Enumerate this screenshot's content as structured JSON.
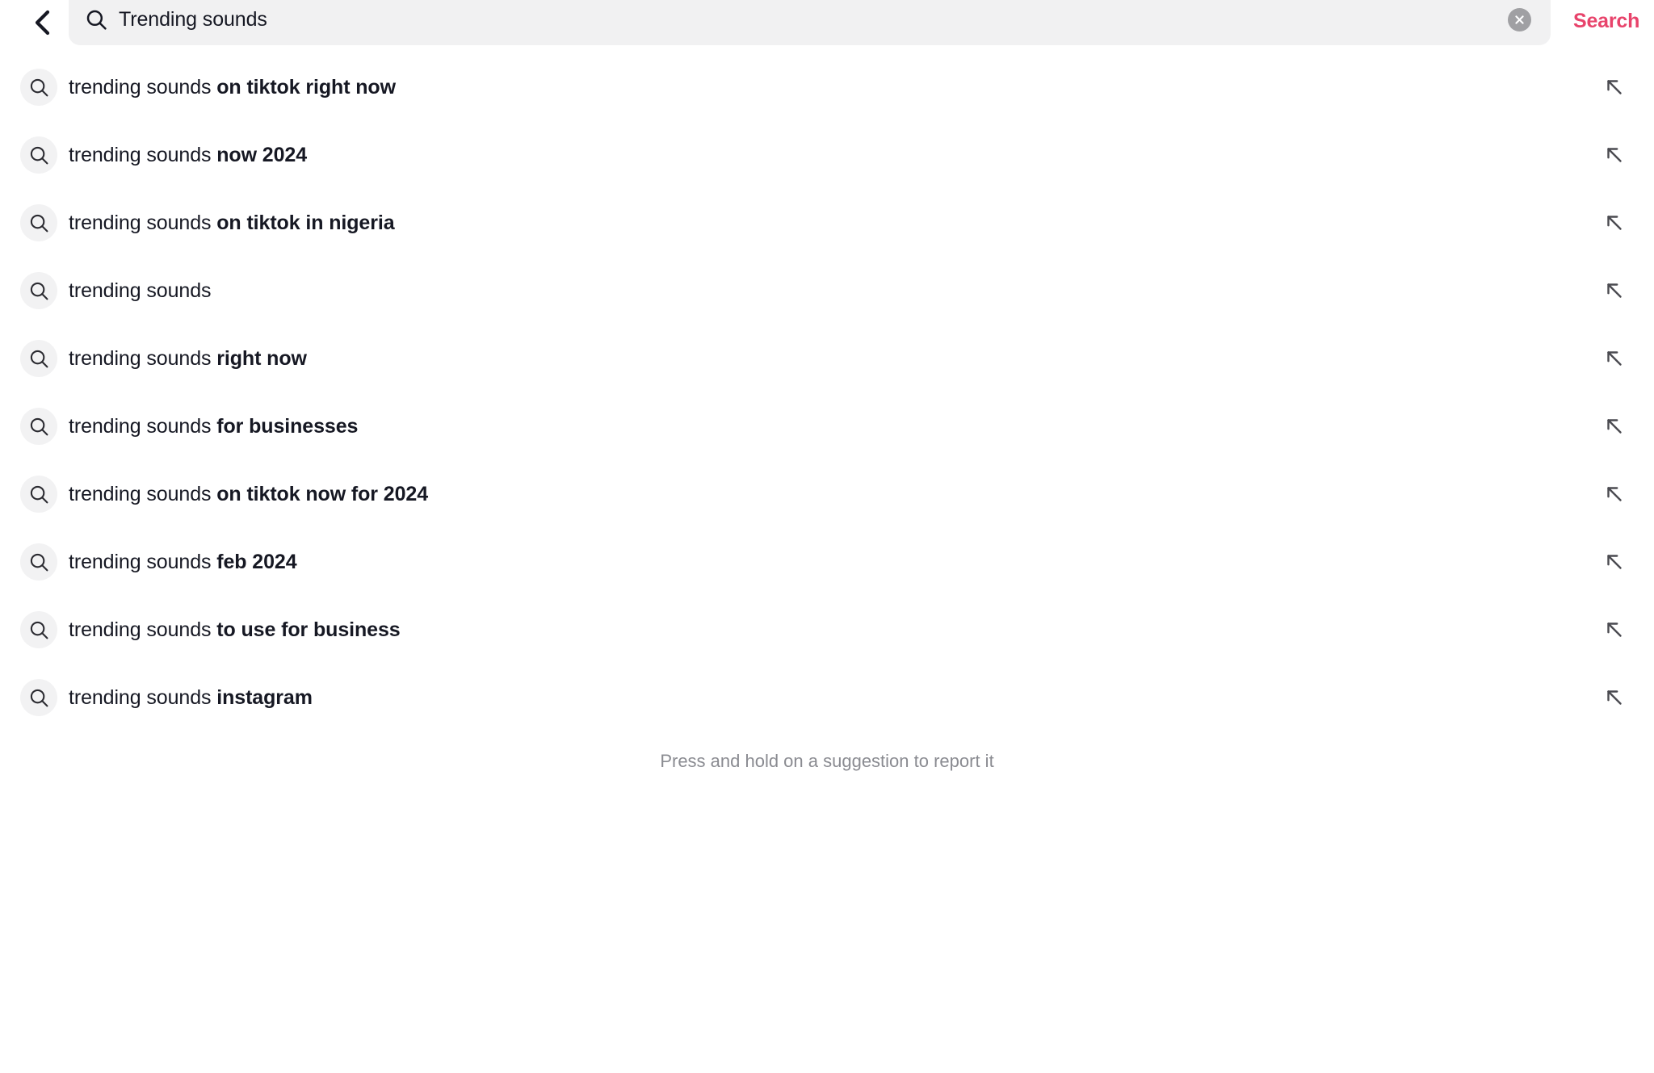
{
  "topbar": {
    "back_label": "Back",
    "search_icon": "search-icon",
    "query_value": "Trending sounds",
    "query_placeholder": "Search",
    "clear_label": "Clear",
    "search_button_label": "Search",
    "accent_color": "#e8436b",
    "field_background": "#f1f1f2"
  },
  "suggestions": {
    "items": [
      {
        "query": "trending sounds ",
        "completion": "on tiktok right now"
      },
      {
        "query": "trending sounds ",
        "completion": "now 2024"
      },
      {
        "query": "trending sounds ",
        "completion": "on tiktok in nigeria"
      },
      {
        "query": "trending sounds",
        "completion": ""
      },
      {
        "query": "trending sounds ",
        "completion": "right now"
      },
      {
        "query": "trending sounds ",
        "completion": "for businesses"
      },
      {
        "query": "trending sounds ",
        "completion": "on tiktok now for 2024"
      },
      {
        "query": "trending sounds ",
        "completion": "feb 2024"
      },
      {
        "query": "trending sounds ",
        "completion": "to use for business"
      },
      {
        "query": "trending sounds ",
        "completion": "instagram"
      }
    ],
    "fill_icon": "arrow-up-left-icon",
    "row_icon": "search-icon"
  },
  "footer": {
    "report_hint": "Press and hold on a suggestion to report it"
  }
}
